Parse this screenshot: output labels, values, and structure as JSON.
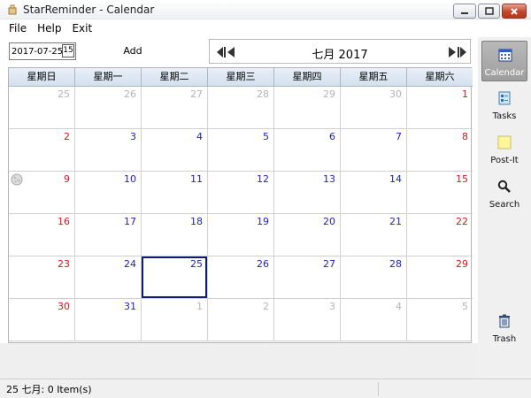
{
  "window": {
    "title": "StarReminder - Calendar"
  },
  "menu": {
    "items": [
      "File",
      "Help",
      "Exit"
    ]
  },
  "toolbar": {
    "date_value": "2017-07-25",
    "picker_glyph": "15",
    "add_label": "Add"
  },
  "nav": {
    "month_label": "七月 2017"
  },
  "calendar": {
    "weekday_headers": [
      "星期日",
      "星期一",
      "星期二",
      "星期三",
      "星期四",
      "星期五",
      "星期六"
    ],
    "weeks": [
      [
        "25",
        "26",
        "27",
        "28",
        "29",
        "30",
        "1"
      ],
      [
        "2",
        "3",
        "4",
        "5",
        "6",
        "7",
        "8"
      ],
      [
        "9",
        "10",
        "11",
        "12",
        "13",
        "14",
        "15"
      ],
      [
        "16",
        "17",
        "18",
        "19",
        "20",
        "21",
        "22"
      ],
      [
        "23",
        "24",
        "25",
        "26",
        "27",
        "28",
        "29"
      ],
      [
        "30",
        "31",
        "1",
        "2",
        "3",
        "4",
        "5"
      ]
    ],
    "selected_day": "25"
  },
  "sidebar": {
    "calendar_label": "Calendar",
    "tasks_label": "Tasks",
    "postit_label": "Post-It",
    "search_label": "Search",
    "trash_label": "Trash"
  },
  "status": {
    "text": "25 七月: 0 Item(s)"
  },
  "colors": {
    "weekend": "#e0141b",
    "weekday": "#1d1dc6",
    "other_month": "#b4b4b4",
    "selection": "#0a1f70"
  }
}
